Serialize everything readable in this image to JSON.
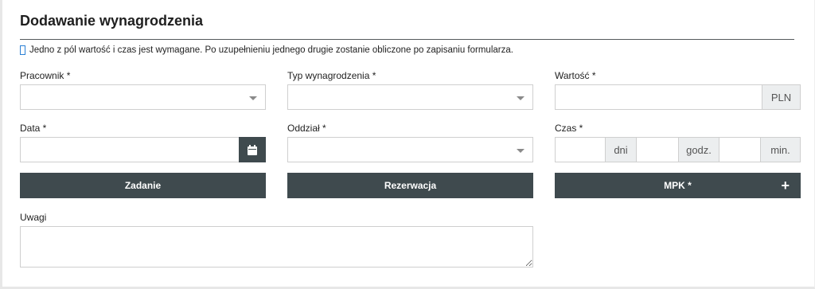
{
  "form": {
    "title": "Dodawanie wynagrodzenia",
    "info": "Jedno z pól wartość i czas jest wymagane. Po uzupełnieniu jednego drugie zostanie obliczone po zapisaniu formularza."
  },
  "fields": {
    "pracownik_label": "Pracownik *",
    "typ_label": "Typ wynagrodzenia *",
    "wartosc_label": "Wartość *",
    "wartosc_currency": "PLN",
    "data_label": "Data *",
    "oddzial_label": "Oddział *",
    "czas_label": "Czas *",
    "czas_dni": "dni",
    "czas_godz": "godz.",
    "czas_min": "min.",
    "uwagi_label": "Uwagi"
  },
  "buttons": {
    "zadanie": "Zadanie",
    "rezerwacja": "Rezerwacja",
    "mpk": "MPK *",
    "mpk_plus": "+"
  },
  "colors": {
    "button_bg": "#3f4a4e",
    "info_icon": "#2a7fd4"
  }
}
